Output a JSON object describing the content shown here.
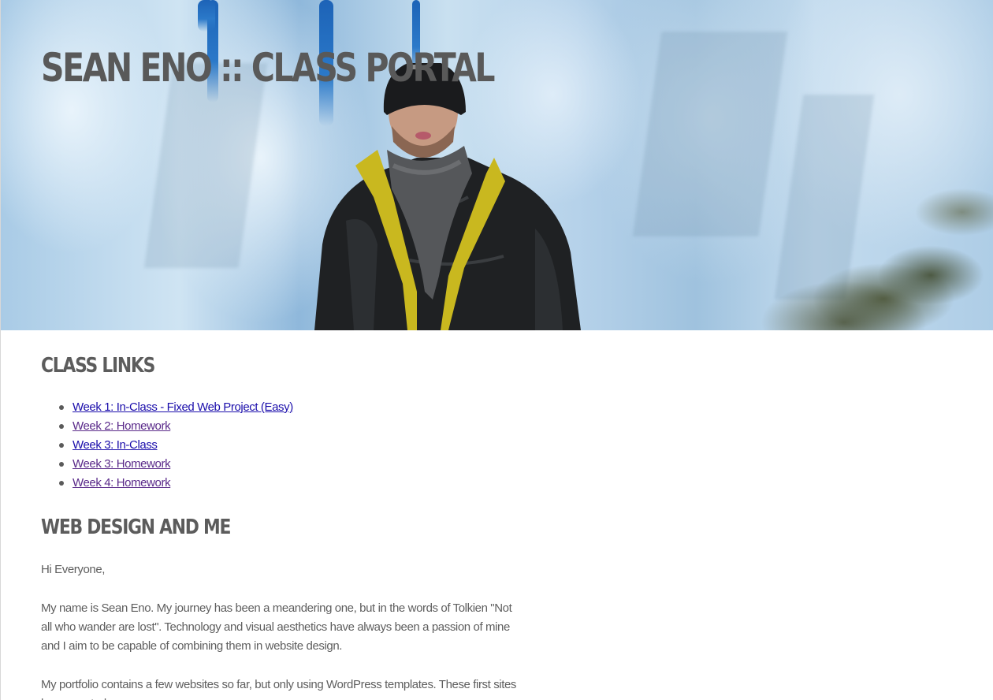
{
  "header": {
    "title": "SEAN ENO :: CLASS PORTAL"
  },
  "class_links": {
    "heading": "CLASS LINKS",
    "items": [
      {
        "label": "Week 1: In-Class - Fixed Web Project (Easy)",
        "visited": false
      },
      {
        "label": "Week 2: Homework",
        "visited": true
      },
      {
        "label": "Week 3: In-Class",
        "visited": false
      },
      {
        "label": "Week 3: Homework",
        "visited": true
      },
      {
        "label": "Week 4: Homework",
        "visited": true
      }
    ]
  },
  "about": {
    "heading": "WEB DESIGN AND ME",
    "greeting": "Hi Everyone,",
    "paragraph_1": "My name is Sean Eno. My journey has been a meandering one, but in the words of Tolkien \"Not all who wander are lost\". Technology and visual aesthetics have always been a passion of mine and I aim to be capable of combining them in website design.",
    "paragraph_2": "My portfolio contains a few websites so far, but only using WordPress templates. These first sites have granted"
  },
  "colors": {
    "link": "#1a0dab",
    "link_visited": "#5a2a8a",
    "heading": "#5c5c5c",
    "text": "#5e5e5e"
  }
}
